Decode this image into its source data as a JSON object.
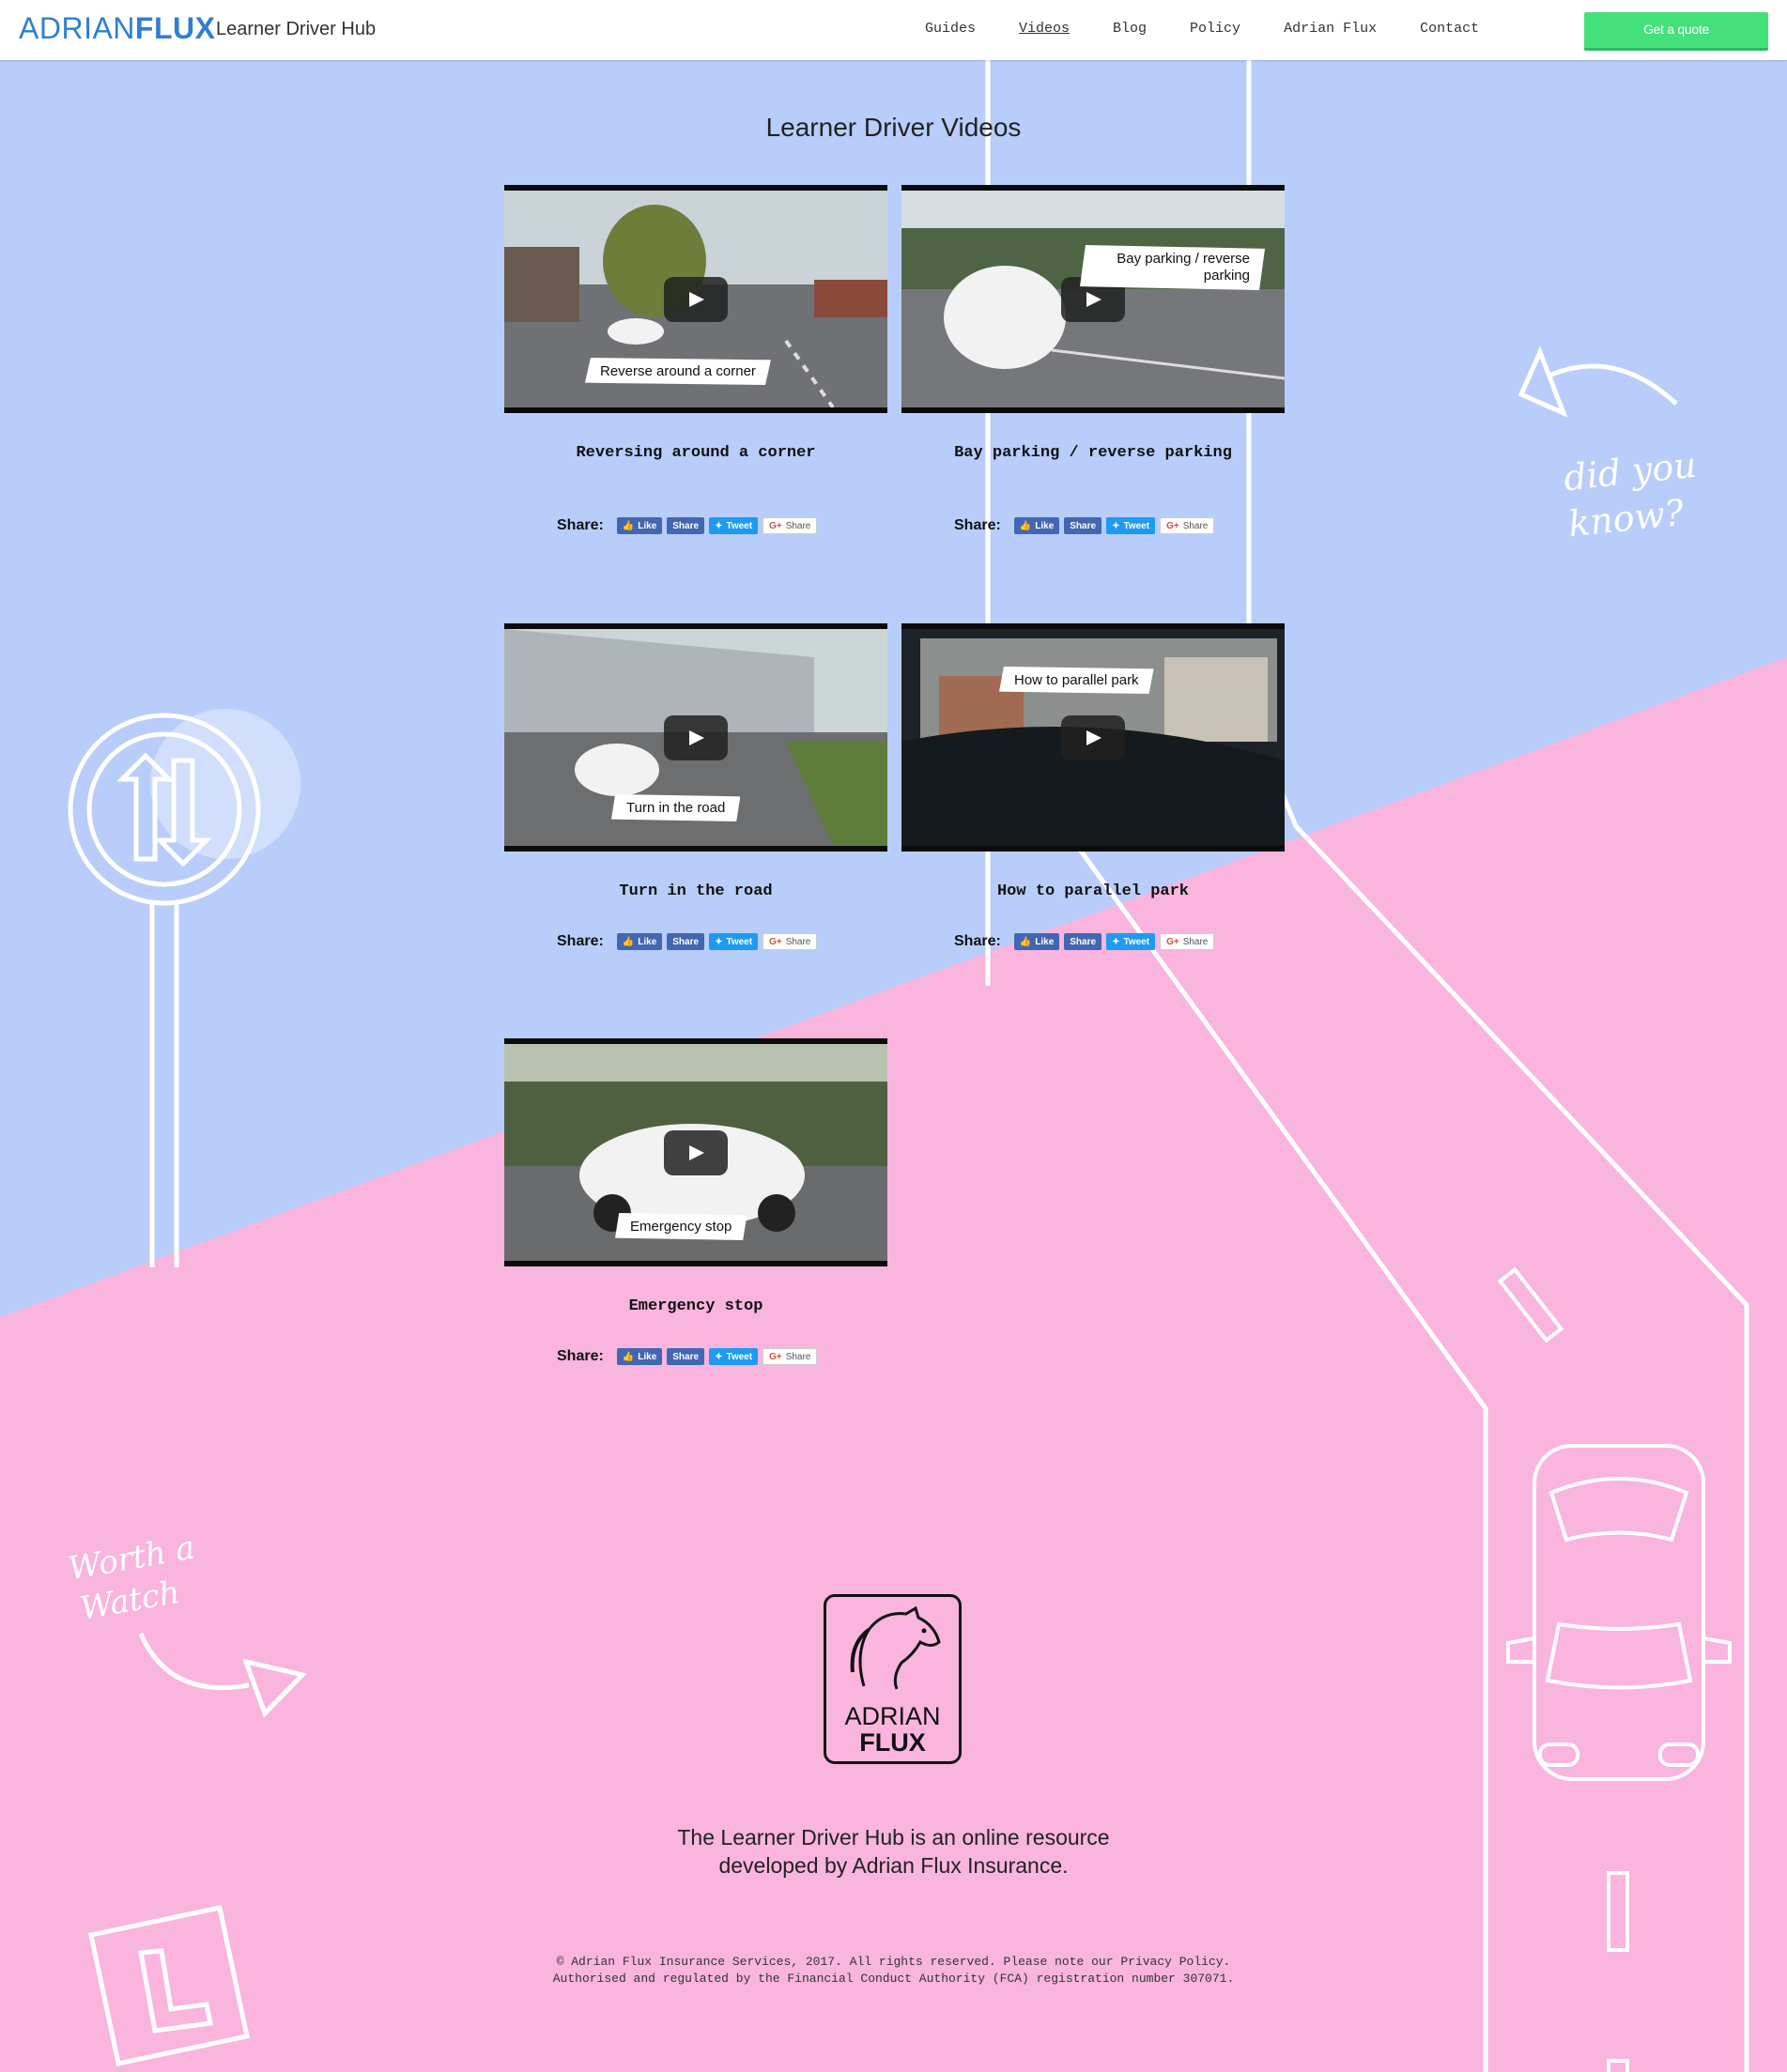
{
  "header": {
    "logo_part1": "ADRIAN",
    "logo_part2": "FLUX",
    "site_title": "Learner Driver Hub",
    "nav": [
      "Guides",
      "Videos",
      "Blog",
      "Policy",
      "Adrian Flux",
      "Contact"
    ],
    "active_nav": "Videos",
    "cta_label": "Get a quote"
  },
  "main": {
    "heading": "Learner Driver Videos",
    "share_label": "Share:",
    "share_buttons": {
      "like": "Like",
      "facebook_share": "Share",
      "tweet": "Tweet",
      "google_share": "Share"
    },
    "videos": [
      {
        "title": "Reversing around a corner",
        "caption": "Reverse around a corner"
      },
      {
        "title": "Bay parking / reverse parking",
        "caption": "Bay parking / reverse parking"
      },
      {
        "title": "Turn in the road",
        "caption": "Turn in the road"
      },
      {
        "title": "How to parallel park",
        "caption": "How to parallel park"
      },
      {
        "title": "Emergency stop",
        "caption": "Emergency stop"
      }
    ]
  },
  "decorations": {
    "did_you_know_1": "did you",
    "did_you_know_2": "know?",
    "worth_a_watch_1": "Worth a",
    "worth_a_watch_2": "Watch"
  },
  "footer": {
    "logo_line1": "ADRIAN",
    "logo_line2": "FLUX",
    "description": "The Learner Driver Hub is an online resource developed by Adrian Flux Insurance.",
    "copyright_line1": "© Adrian Flux Insurance Services, 2017. All rights reserved. Please note our Privacy Policy.",
    "copyright_line2": "Authorised and regulated by the Financial Conduct Authority (FCA) registration number 307071."
  },
  "colors": {
    "blue_bg": "#b9cdfa",
    "pink_bg": "#f9b5dd",
    "brand_blue": "#2e7fd4",
    "cta_green": "#44e07c"
  }
}
